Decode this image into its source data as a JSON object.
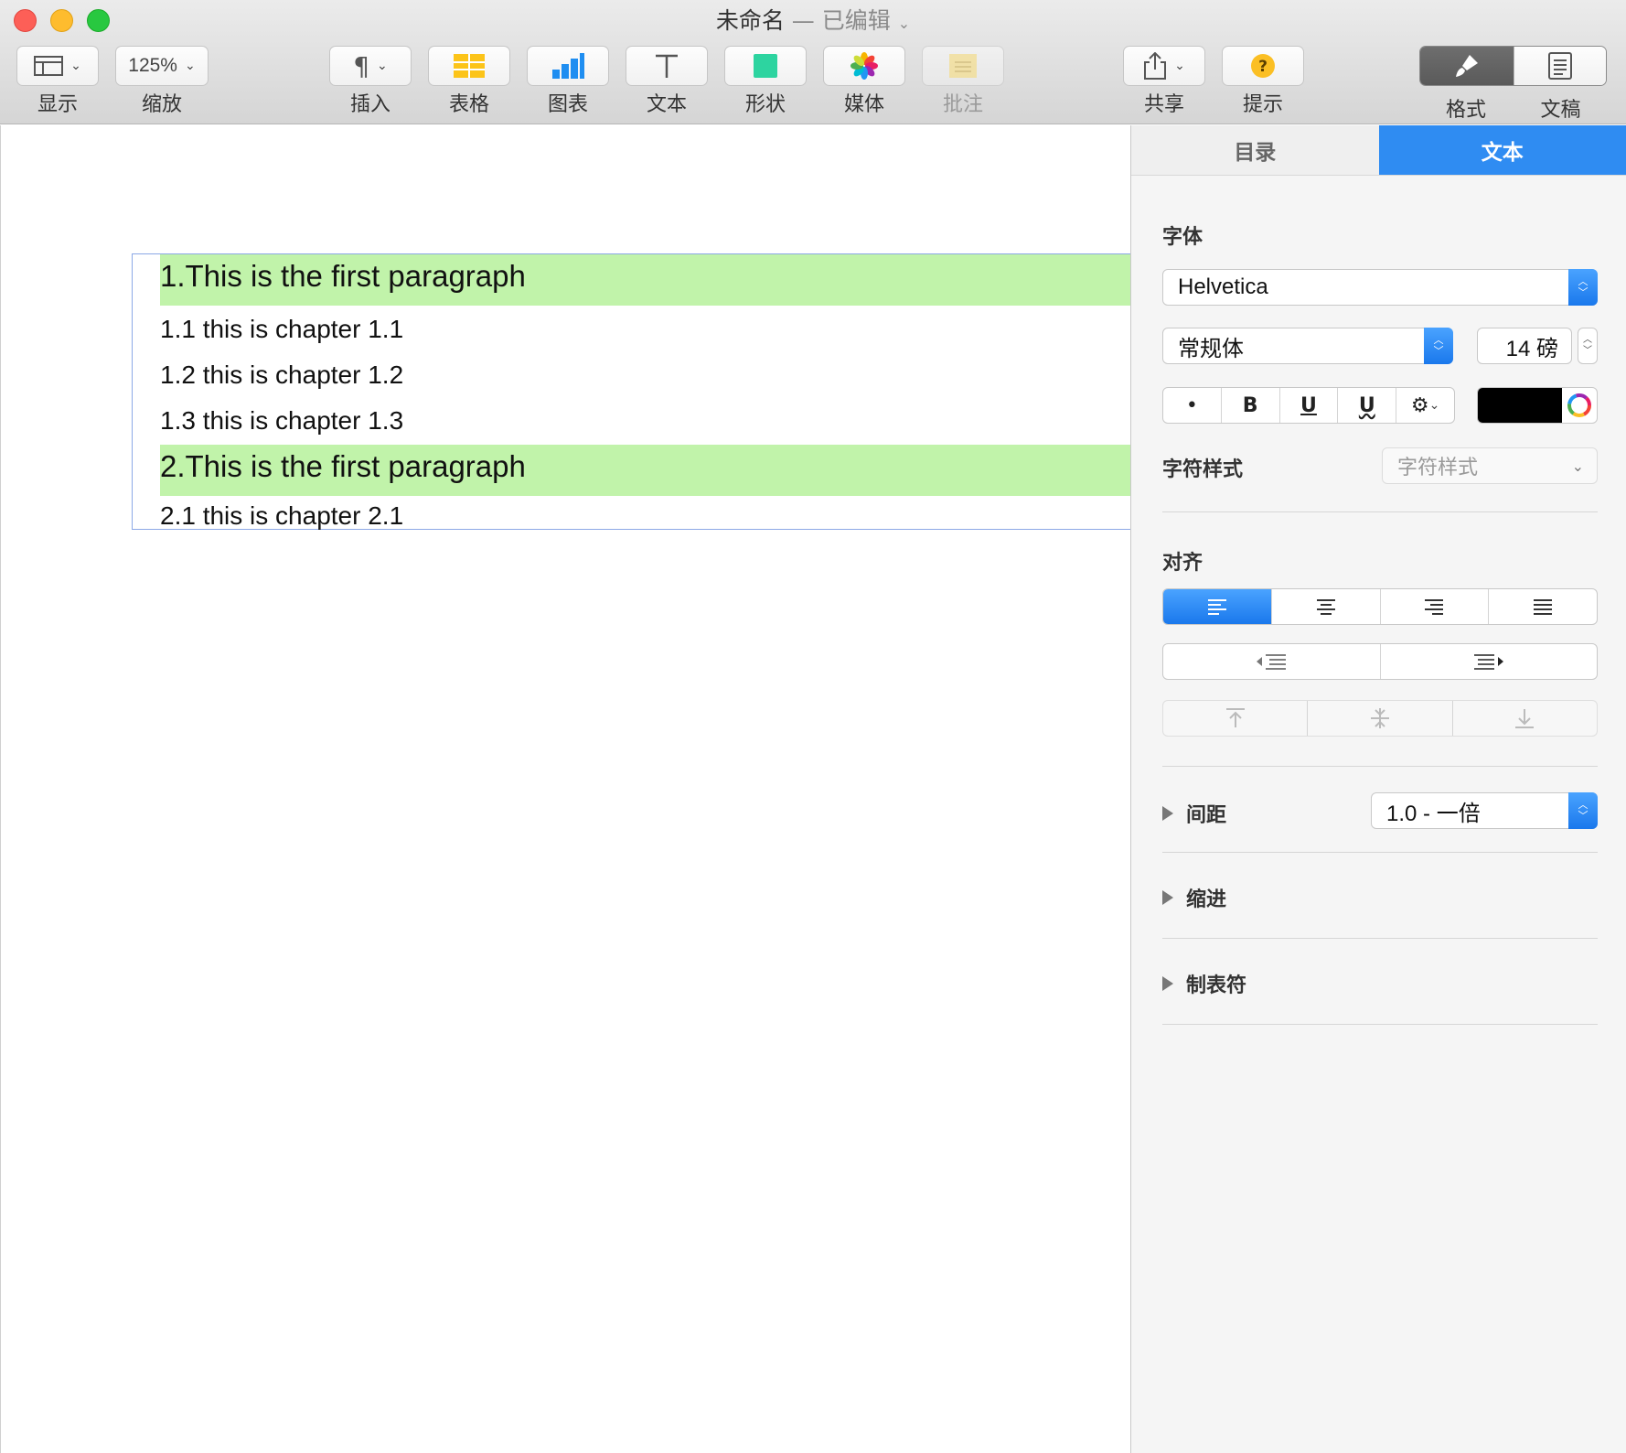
{
  "window": {
    "title": "未命名",
    "separator": " — ",
    "edited": "已编辑"
  },
  "toolbar": {
    "view_label": "显示",
    "zoom_value": "125%",
    "zoom_label": "缩放",
    "insert_label": "插入",
    "table_label": "表格",
    "chart_label": "图表",
    "text_label": "文本",
    "shape_label": "形状",
    "media_label": "媒体",
    "comment_label": "批注",
    "share_label": "共享",
    "tips_label": "提示",
    "format_label": "格式",
    "document_label": "文稿"
  },
  "document": {
    "paragraphs": [
      {
        "text": "1.This is the first paragraph",
        "style": "heading"
      },
      {
        "text": "1.1 this is chapter 1.1",
        "style": "sub"
      },
      {
        "text": "1.2 this is chapter 1.2",
        "style": "sub"
      },
      {
        "text": "1.3 this is chapter 1.3",
        "style": "sub"
      },
      {
        "text": "2.This is the first paragraph",
        "style": "heading"
      },
      {
        "text": "2.1 this is chapter 2.1",
        "style": "sub"
      }
    ],
    "highlight_color": "#c1f3aa"
  },
  "inspector": {
    "tabs": [
      {
        "label": "目录",
        "active": false
      },
      {
        "label": "文本",
        "active": true
      }
    ],
    "font": {
      "section_label": "字体",
      "family": "Helvetica",
      "typeface": "常规体",
      "size": "14 磅",
      "bullet": "•",
      "bold": "B",
      "underline": "U",
      "double_underline": "U",
      "text_color": "#000000"
    },
    "char_style": {
      "label": "字符样式",
      "value": "字符样式"
    },
    "alignment": {
      "label": "对齐",
      "selected": "left"
    },
    "spacing": {
      "label": "间距",
      "value": "1.0 - 一倍"
    },
    "indent_label": "缩进",
    "tabs_label": "制表符",
    "accent_color": "#2f8cf2"
  }
}
